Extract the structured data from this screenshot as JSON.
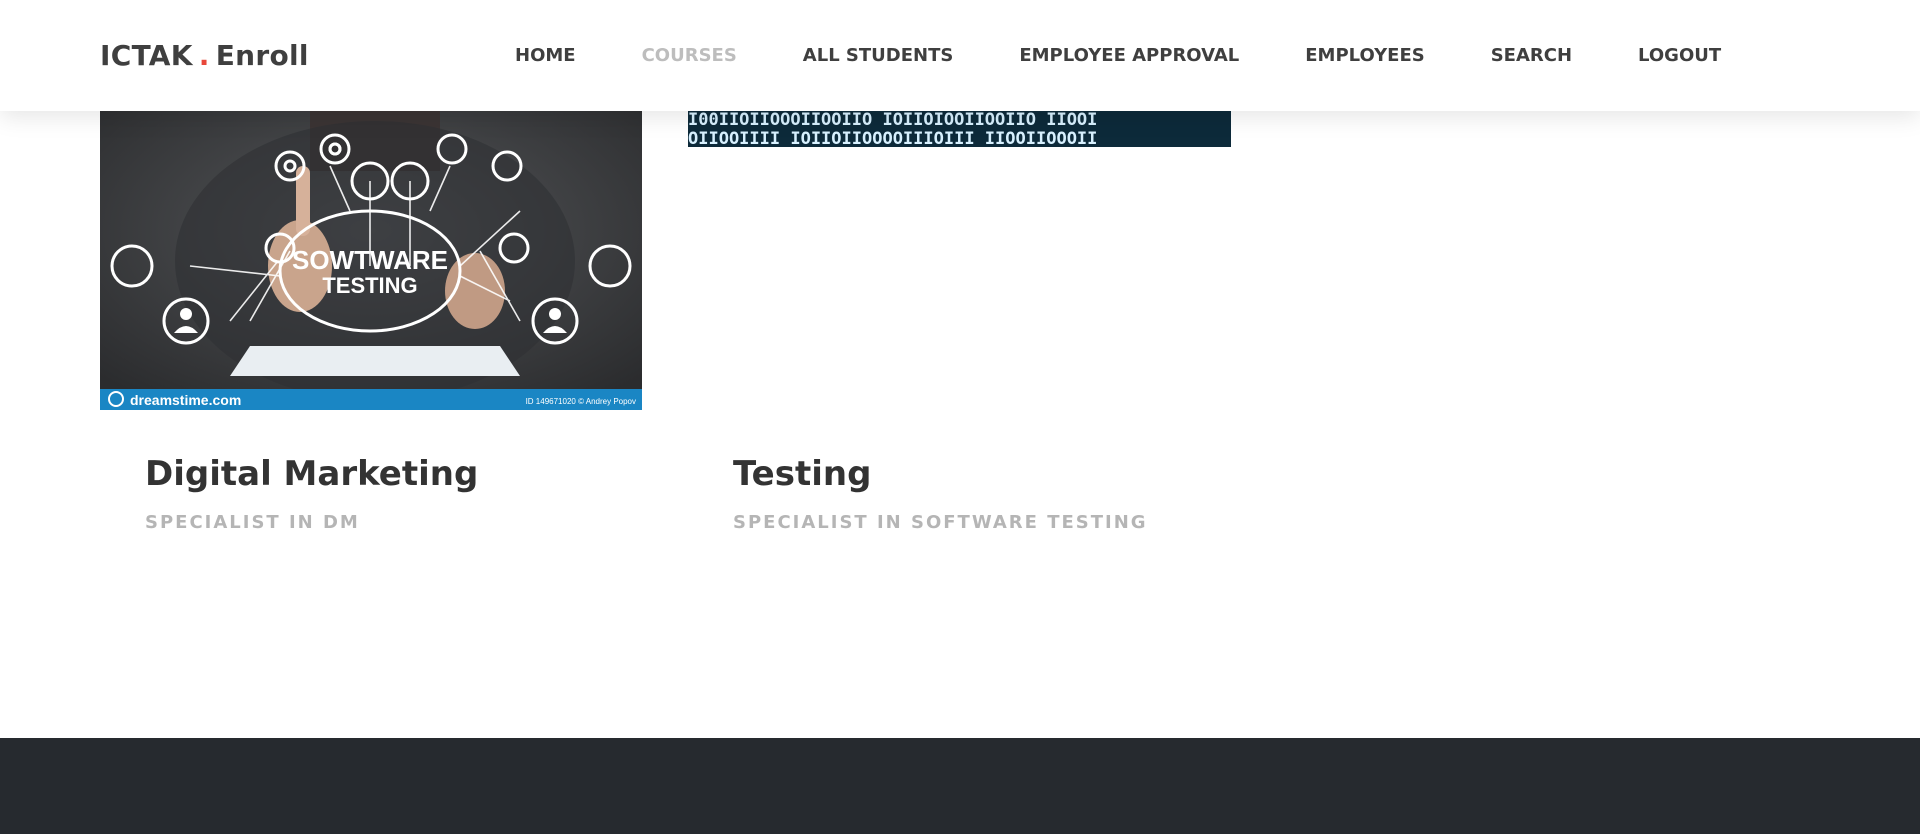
{
  "brand": {
    "name_left": "ICTAK",
    "dot": ".",
    "name_right": "Enroll",
    "dot_color": "#e8483b"
  },
  "nav": {
    "items": [
      {
        "label": "HOME",
        "active": false
      },
      {
        "label": "COURSES",
        "active": true
      },
      {
        "label": "ALL STUDENTS",
        "active": false
      },
      {
        "label": "EMPLOYEE APPROVAL",
        "active": false
      },
      {
        "label": "EMPLOYEES",
        "active": false
      },
      {
        "label": "SEARCH",
        "active": false
      },
      {
        "label": "LOGOUT",
        "active": false
      }
    ]
  },
  "courses": [
    {
      "title": "Digital Marketing",
      "subtitle": "SPECIALIST IN DM",
      "image": {
        "cloud_text_line1": "SOWTWARE",
        "cloud_text_line2": "TESTING",
        "watermark": "dreamstime.com",
        "watermark_id": "ID 149671020 © Andrey Popov"
      }
    },
    {
      "title": "Testing",
      "subtitle": "SPECIALIST IN SOFTWARE TESTING",
      "image": {
        "binary_row1": "I00IIOIIOOOIIOOIIO IOIIOIOOIIOOIIO IIOOI",
        "binary_row2": "OIIOOIIII IOIIOIIOOOOIIIOIII IIOOIIOOOII"
      }
    }
  ],
  "colors": {
    "text_dark": "#3f3f3f",
    "nav_active": "#bdbdbd",
    "subtitle": "#b5b5b5",
    "footer_bg": "#262a2f"
  }
}
